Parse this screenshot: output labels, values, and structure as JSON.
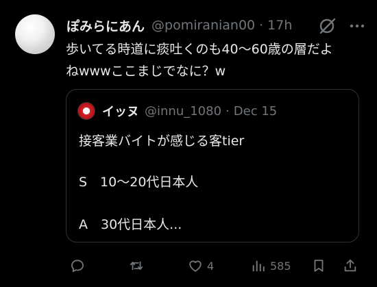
{
  "tweet": {
    "display_name": "ぽみらにあん",
    "handle": "@pomiranian00",
    "separator": "·",
    "time": "17h",
    "text_line1": "歩いてる時道に痰吐くのも40〜60歳の層だよ",
    "text_line2": "ねwwwここまじでなに？w",
    "icons": {
      "grok": "grok-icon",
      "more": "more-icon"
    }
  },
  "quote": {
    "display_name": "イッヌ",
    "handle": "@innu_1080",
    "separator": "·",
    "time": "Dec 15",
    "line1": "接客業バイトが感じる客tier",
    "line2": "S　10〜20代日本人",
    "line3": "A　30代日本人..."
  },
  "actions": {
    "reply_count": "",
    "retweet_count": "",
    "like_count": "4",
    "views_count": "585",
    "icons": [
      "reply-icon",
      "retweet-icon",
      "like-icon",
      "views-icon",
      "bookmark-icon",
      "share-icon"
    ]
  },
  "colors": {
    "background": "#000000",
    "text": "#e7e9ea",
    "secondary": "#71767b",
    "border": "#2f3336"
  }
}
